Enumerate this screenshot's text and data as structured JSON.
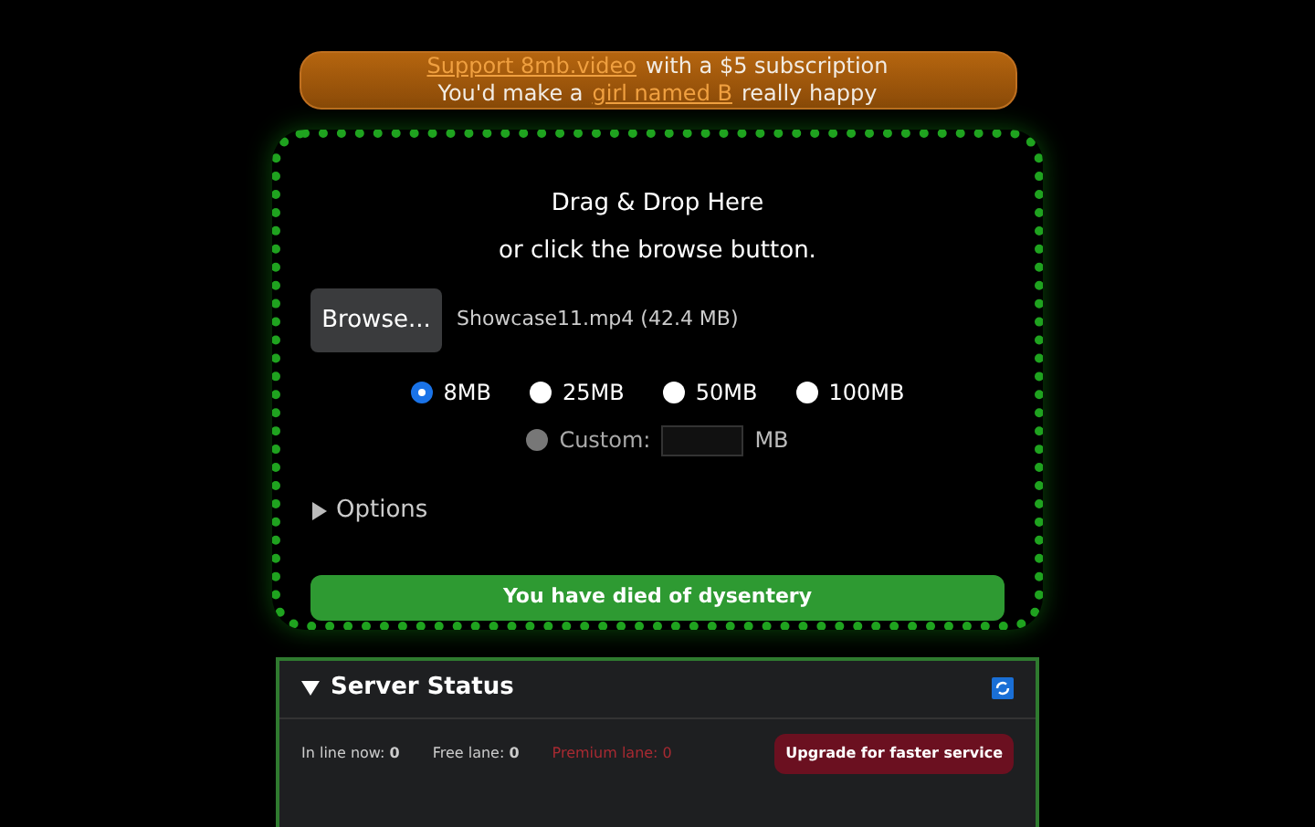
{
  "banner": {
    "line_1": [
      {
        "text": "Support 8mb.video",
        "link": true
      },
      {
        "text": "with a $5 subscription",
        "link": false
      }
    ],
    "line_2": [
      {
        "text": "You'd make a",
        "link": false
      },
      {
        "text": "girl named B",
        "link": true
      },
      {
        "text": "really happy",
        "link": false
      }
    ]
  },
  "dropzone": {
    "title": "Drag & Drop Here",
    "subtitle": "or click the browse button.",
    "browse_button": "Browse...",
    "file": "Showcase11.mp4 (42.4 MB)",
    "sizes": [
      {
        "label": "8MB",
        "selected": true
      },
      {
        "label": "25MB",
        "selected": false
      },
      {
        "label": "50MB",
        "selected": false
      },
      {
        "label": "100MB",
        "selected": false
      }
    ],
    "custom": {
      "label": "Custom:",
      "selected": false,
      "disabled": true,
      "unit": "MB"
    },
    "options": {
      "label": "Options",
      "expanded": false
    },
    "submit_button": "You have died of dysentery"
  },
  "server_status": {
    "title": "Server Status",
    "expanded": true,
    "stats": [
      {
        "text": "In line now: **0**",
        "kind": "normal"
      },
      {
        "text": "Free lane: **0**",
        "kind": "normal"
      },
      {
        "text": "Premium lane: 0",
        "kind": "premium"
      }
    ],
    "upgrade_button": "Upgrade for faster service"
  }
}
